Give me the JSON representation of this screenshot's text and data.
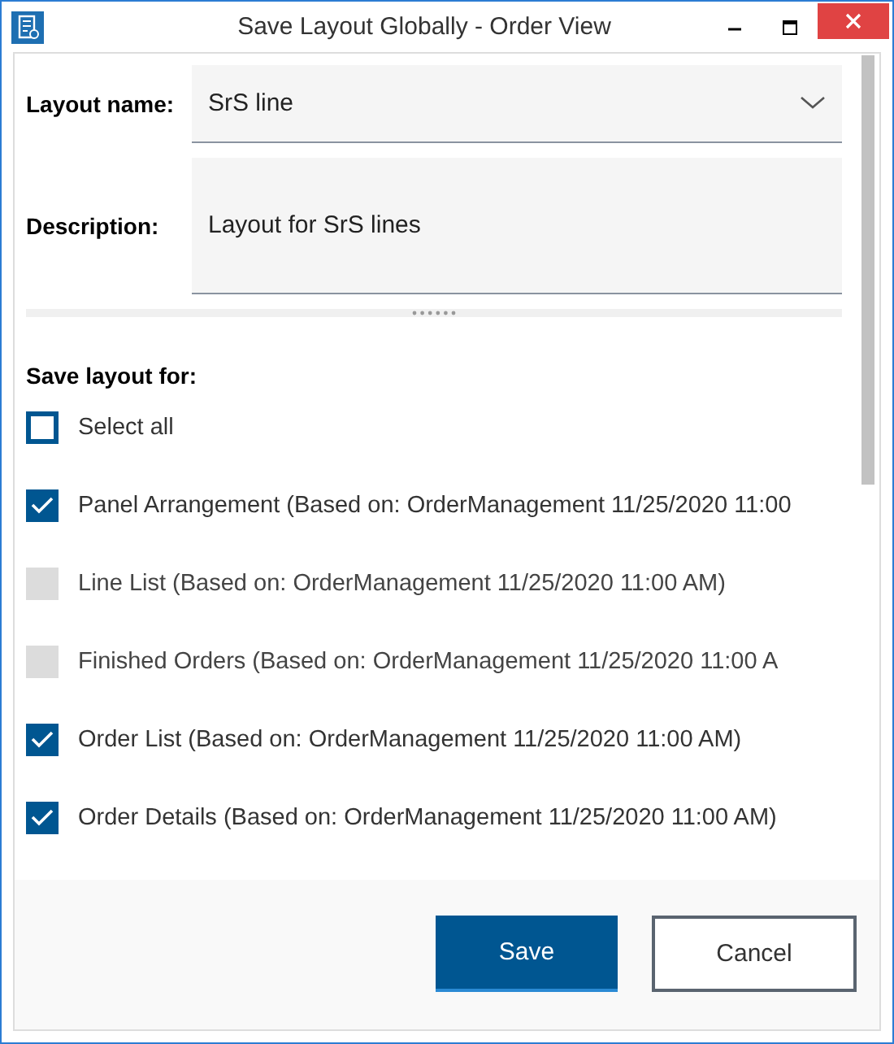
{
  "window": {
    "title": "Save Layout Globally - Order View"
  },
  "layout_name": {
    "label": "Layout name:",
    "value": "SrS line"
  },
  "description": {
    "label": "Description:",
    "value": "Layout for SrS lines"
  },
  "save_for": {
    "label": "Save layout for:",
    "items": [
      {
        "label": "Select all",
        "checked": false,
        "disabled": false
      },
      {
        "label": "Panel Arrangement (Based on: OrderManagement 11/25/2020 11:00",
        "checked": true,
        "disabled": false
      },
      {
        "label": "Line List (Based on: OrderManagement 11/25/2020 11:00 AM)",
        "checked": false,
        "disabled": true
      },
      {
        "label": "Finished Orders (Based on: OrderManagement 11/25/2020 11:00 A",
        "checked": false,
        "disabled": true
      },
      {
        "label": "Order List (Based on: OrderManagement 11/25/2020 11:00 AM)",
        "checked": true,
        "disabled": false
      },
      {
        "label": "Order Details (Based on: OrderManagement 11/25/2020 11:00 AM)",
        "checked": true,
        "disabled": false
      }
    ]
  },
  "buttons": [
    {
      "label": "Save",
      "kind": "primary"
    },
    {
      "label": "Cancel",
      "kind": "secondary"
    }
  ]
}
